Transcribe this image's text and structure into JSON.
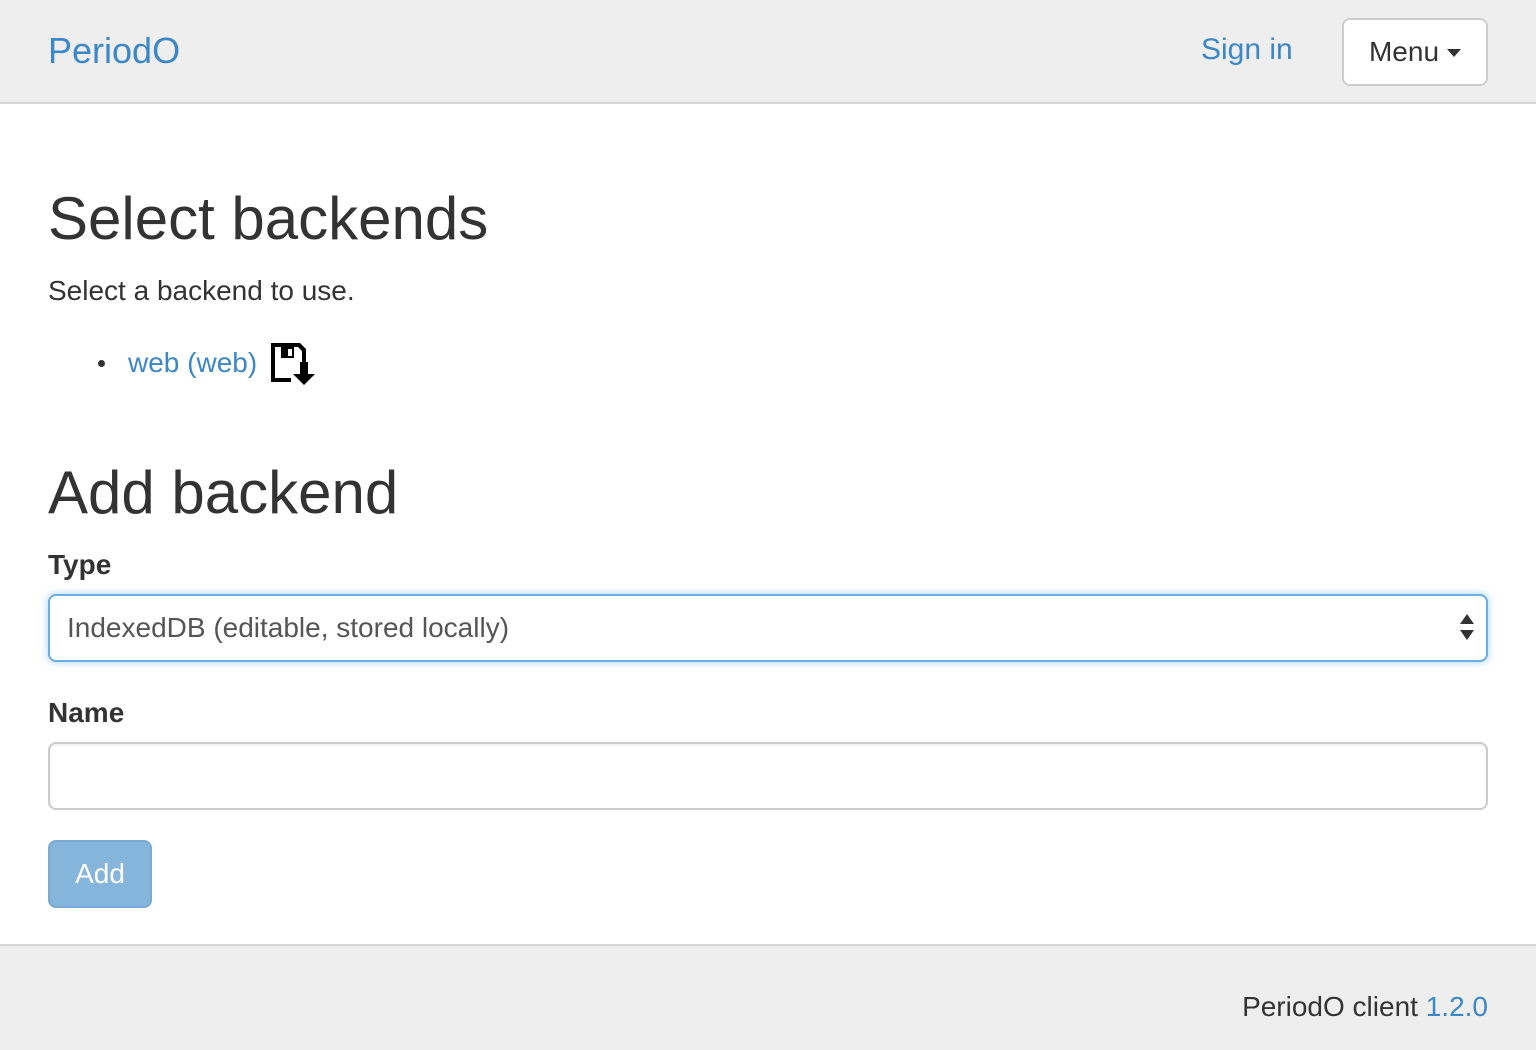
{
  "header": {
    "brand": "PeriodO",
    "signin_label": "Sign in",
    "menu_label": "Menu"
  },
  "select_section": {
    "title": "Select backends",
    "description": "Select a backend to use.",
    "backends": [
      {
        "label": "web (web)",
        "action_icon": "save-download-icon"
      }
    ]
  },
  "add_section": {
    "title": "Add backend",
    "type_label": "Type",
    "type_selected": "IndexedDB (editable, stored locally)",
    "name_label": "Name",
    "name_value": "",
    "name_placeholder": "",
    "add_button": "Add"
  },
  "footer": {
    "client_text": "PeriodO client",
    "version": "1.2.0"
  },
  "colors": {
    "link": "#3c87c7",
    "navbar_bg": "#eeeeee",
    "focus_border": "#66afe9",
    "add_button_bg": "#86b5dc"
  }
}
